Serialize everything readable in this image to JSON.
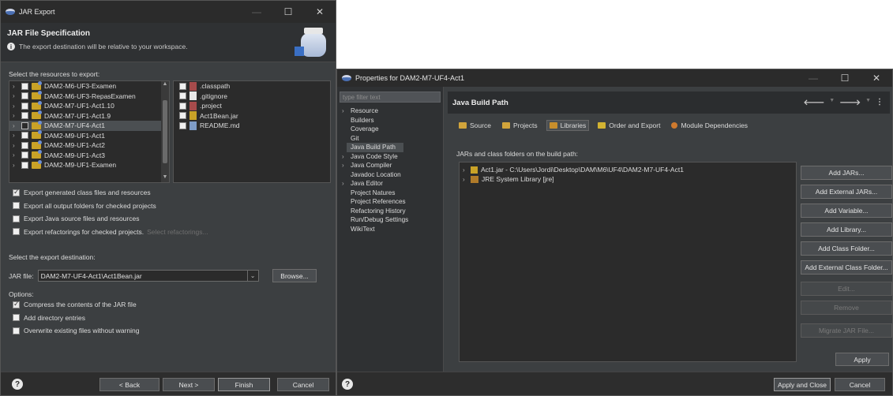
{
  "jar_export": {
    "window_title": "JAR Export",
    "controls": {
      "minimize": "—",
      "maximize": "☐",
      "close": "✕"
    },
    "banner": {
      "title": "JAR File Specification",
      "message": "The export destination will be relative to your workspace."
    },
    "resources_label": "Select the resources to export:",
    "projects": [
      {
        "label": "DAM2-M6-UF3-Examen",
        "checked": false
      },
      {
        "label": "DAM2-M6-UF3-RepasExamen",
        "checked": false
      },
      {
        "label": "DAM2-M7-UF1-Act1.10",
        "checked": false
      },
      {
        "label": "DAM2-M7-UF1-Act1.9",
        "checked": false
      },
      {
        "label": "DAM2-M7-UF4-Act1",
        "checked": false,
        "selected": true
      },
      {
        "label": "DAM2-M9-UF1-Act1",
        "checked": false
      },
      {
        "label": "DAM2-M9-UF1-Act2",
        "checked": false
      },
      {
        "label": "DAM2-M9-UF1-Act3",
        "checked": false
      },
      {
        "label": "DAM2-M9-UF1-Examen",
        "checked": false
      }
    ],
    "files": [
      {
        "label": ".classpath",
        "icon": "xml-file-icon"
      },
      {
        "label": ".gitignore",
        "icon": "text-file-icon"
      },
      {
        "label": ".project",
        "icon": "xml-file-icon"
      },
      {
        "label": "Act1Bean.jar",
        "icon": "jar-file-icon"
      },
      {
        "label": "README.md",
        "icon": "markdown-file-icon"
      }
    ],
    "options_top": [
      {
        "label": "Export generated class files and resources",
        "checked": true
      },
      {
        "label": "Export all output folders for checked projects",
        "checked": false
      },
      {
        "label": "Export Java source files and resources",
        "checked": false
      },
      {
        "label": "Export refactorings for checked projects.",
        "checked": false,
        "link": "Select refactorings..."
      }
    ],
    "destination_label": "Select the export destination:",
    "jar_file_label": "JAR file:",
    "jar_file_value": "DAM2-M7-UF4-Act1\\Act1Bean.jar",
    "browse_label": "Browse...",
    "options_label": "Options:",
    "options_bottom": [
      {
        "label": "Compress the contents of the JAR file",
        "checked": true
      },
      {
        "label": "Add directory entries",
        "checked": false
      },
      {
        "label": "Overwrite existing files without warning",
        "checked": false
      }
    ],
    "buttons": {
      "help": "?",
      "back": "< Back",
      "next": "Next >",
      "finish": "Finish",
      "cancel": "Cancel"
    }
  },
  "properties": {
    "window_title": "Properties for DAM2-M7-UF4-Act1",
    "filter_placeholder": "type filter text",
    "nav": [
      {
        "label": "Resource",
        "expandable": true
      },
      {
        "label": "Builders"
      },
      {
        "label": "Coverage"
      },
      {
        "label": "Git"
      },
      {
        "label": "Java Build Path",
        "selected": true
      },
      {
        "label": "Java Code Style",
        "expandable": true
      },
      {
        "label": "Java Compiler",
        "expandable": true
      },
      {
        "label": "Javadoc Location"
      },
      {
        "label": "Java Editor",
        "expandable": true
      },
      {
        "label": "Project Natures"
      },
      {
        "label": "Project References"
      },
      {
        "label": "Refactoring History"
      },
      {
        "label": "Run/Debug Settings"
      },
      {
        "label": "WikiText"
      }
    ],
    "page_title": "Java Build Path",
    "tabs": [
      {
        "label": "Source",
        "icon": "source-folder-icon"
      },
      {
        "label": "Projects",
        "icon": "projects-folder-icon"
      },
      {
        "label": "Libraries",
        "icon": "libraries-icon",
        "active": true
      },
      {
        "label": "Order and Export",
        "icon": "order-export-icon"
      },
      {
        "label": "Module Dependencies",
        "icon": "module-icon"
      }
    ],
    "build_path_label": "JARs and class folders on the build path:",
    "entries": [
      {
        "label": "Act1.jar - C:\\Users\\Jordi\\Desktop\\DAM\\M6\\UF4\\DAM2-M7-UF4-Act1",
        "icon": "jar-icon"
      },
      {
        "label": "JRE System Library [jre]",
        "icon": "library-icon"
      }
    ],
    "side_buttons": [
      {
        "label": "Add JARs...",
        "enabled": true
      },
      {
        "label": "Add External JARs...",
        "enabled": true
      },
      {
        "label": "Add Variable...",
        "enabled": true
      },
      {
        "label": "Add Library...",
        "enabled": true
      },
      {
        "label": "Add Class Folder...",
        "enabled": true
      },
      {
        "label": "Add External Class Folder...",
        "enabled": true
      },
      {
        "label": "Edit...",
        "enabled": false
      },
      {
        "label": "Remove",
        "enabled": false
      },
      {
        "label": "Migrate JAR File...",
        "enabled": false
      }
    ],
    "apply_label": "Apply",
    "footer": {
      "help": "?",
      "apply_close": "Apply and Close",
      "cancel": "Cancel"
    }
  }
}
